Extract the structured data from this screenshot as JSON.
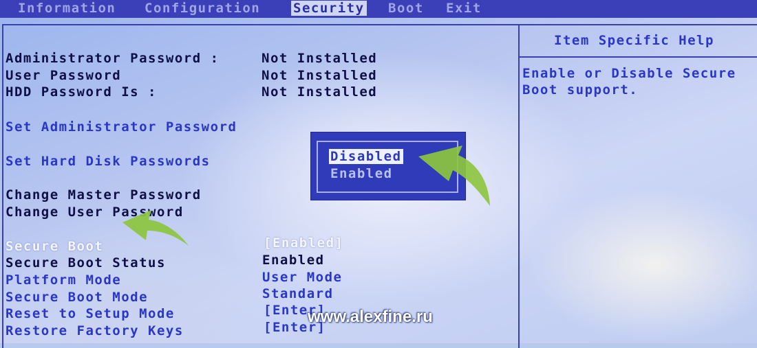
{
  "menu": {
    "tabs": [
      "Information",
      "Configuration",
      "Security",
      "Boot",
      "Exit"
    ],
    "active": "Security"
  },
  "status": {
    "admin_label": "Administrator Password :",
    "admin_value": "Not Installed",
    "user_label": "User Password",
    "user_value": "Not Installed",
    "hdd_label": "HDD Password Is :",
    "hdd_value": "Not Installed"
  },
  "actions": {
    "set_admin": "Set Administrator Password",
    "set_hdd": "Set Hard Disk Passwords",
    "change_master": "Change Master Password",
    "change_user": "Change User Password"
  },
  "secure": {
    "secure_boot_label": "Secure Boot",
    "secure_boot_value": "[Enabled]",
    "status_label": "Secure Boot Status",
    "status_value": "Enabled",
    "platform_label": "Platform Mode",
    "platform_value": "User Mode",
    "mode_label": "Secure Boot Mode",
    "mode_value": "Standard",
    "reset_label": "Reset to Setup Mode",
    "reset_value": "[Enter]",
    "restore_label": "Restore Factory Keys",
    "restore_value": "[Enter]"
  },
  "popup": {
    "options": [
      "Disabled",
      "Enabled"
    ],
    "selected": "Disabled"
  },
  "help": {
    "title": "Item Specific Help",
    "line1": "Enable or Disable Secure",
    "line2": "Boot support."
  },
  "watermark": "www.alexfine.ru",
  "colors": {
    "menubar": "#3b3fb8",
    "frame": "#3a3fae",
    "label_dark": "#0e0f45",
    "label_blue": "#2a37c4",
    "popup_bg": "#2f3bb8",
    "arrow_green": "#8dc63f"
  },
  "icons": [
    "arrow-pointer-icon"
  ]
}
